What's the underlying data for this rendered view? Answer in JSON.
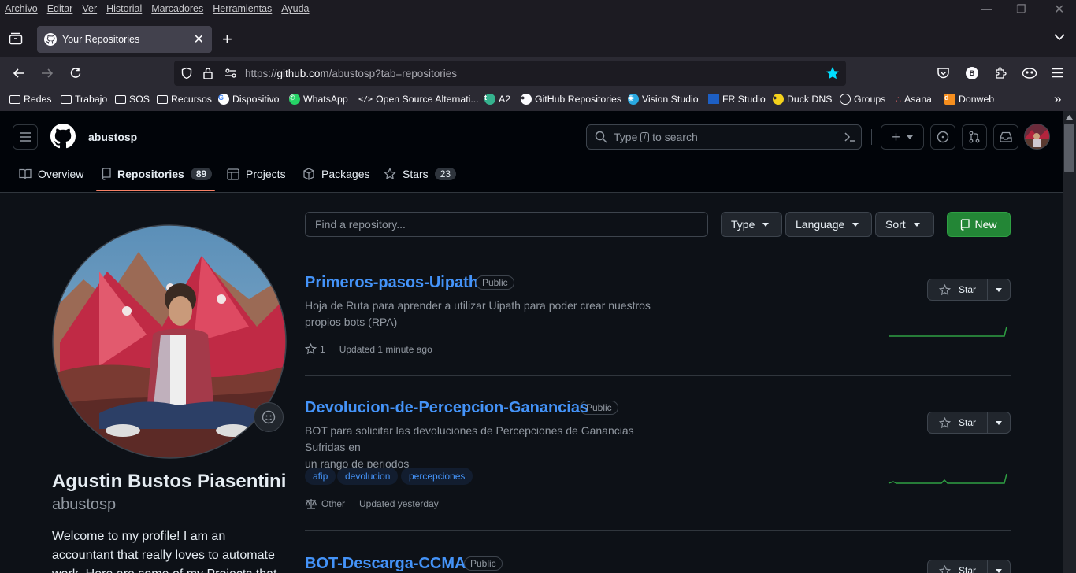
{
  "browser": {
    "menu": [
      "Archivo",
      "Editar",
      "Ver",
      "Historial",
      "Marcadores",
      "Herramientas",
      "Ayuda"
    ],
    "tab_title": "Your Repositories",
    "url_prefix": "https://",
    "url_domain": "github.com",
    "url_path": "/abustosp?tab=repositories",
    "extension_letter": "B",
    "bookmarks": [
      {
        "label": "Redes",
        "icon": "folder-icon"
      },
      {
        "label": "Trabajo",
        "icon": "folder-icon"
      },
      {
        "label": "SOS",
        "icon": "folder-icon"
      },
      {
        "label": "Recursos",
        "icon": "folder-icon"
      },
      {
        "label": "Dispositivo",
        "icon": "google-icon"
      },
      {
        "label": "WhatsApp",
        "icon": "whatsapp-icon"
      },
      {
        "label": "Open Source Alternati...",
        "icon": "code-icon"
      },
      {
        "label": "A2",
        "icon": "a2-icon"
      },
      {
        "label": "GitHub Repositories",
        "icon": "github-icon"
      },
      {
        "label": "Vision Studio",
        "icon": "vision-icon"
      },
      {
        "label": "FR Studio",
        "icon": "fr-studio-icon"
      },
      {
        "label": "Duck DNS",
        "icon": "duck-icon"
      },
      {
        "label": "Groups",
        "icon": "globe-icon"
      },
      {
        "label": "Asana",
        "icon": "asana-icon"
      },
      {
        "label": "Donweb",
        "icon": "donweb-icon"
      }
    ],
    "colors": {
      "accent": "#00ddff",
      "menubar_bg": "#1c1b22",
      "navbar_bg": "#2b2a33"
    }
  },
  "github": {
    "username": "abustosp",
    "search_placeholder_before": "Type",
    "search_key": "/",
    "search_placeholder_after": "to search",
    "tabs": [
      {
        "label": "Overview",
        "count": null,
        "icon": "book-icon"
      },
      {
        "label": "Repositories",
        "count": "89",
        "icon": "repo-icon"
      },
      {
        "label": "Projects",
        "count": null,
        "icon": "table-icon"
      },
      {
        "label": "Packages",
        "count": null,
        "icon": "package-icon"
      },
      {
        "label": "Stars",
        "count": "23",
        "icon": "star-icon"
      }
    ],
    "profile": {
      "full_name": "Agustin Bustos Piasentini",
      "login": "abustosp",
      "bio_lines": [
        "Welcome to my profile! I am an",
        "accountant that really loves to automate",
        "work. Here are some of my Projects that"
      ]
    },
    "find_placeholder": "Find a repository...",
    "filters": [
      "Type",
      "Language",
      "Sort"
    ],
    "new_button": "New",
    "star_label": "Star",
    "repos": [
      {
        "name": "Primeros-pasos-Uipath",
        "visibility": "Public",
        "description_lines": [
          "Hoja de Ruta para aprender a utilizar Uipath para poder crear nuestros",
          "propios bots (RPA)"
        ],
        "topics": [],
        "stars": "1",
        "license": "",
        "updated": "Updated 1 minute ago"
      },
      {
        "name": "Devolucion-de-Percepcion-Ganancias",
        "visibility": "Public",
        "description_lines": [
          "BOT para solicitar las devoluciones de Percepciones de Ganancias Sufridas en",
          "un rango de periodos"
        ],
        "topics": [
          "afip",
          "devolucion",
          "percepciones"
        ],
        "stars": "",
        "license": "Other",
        "updated": "Updated yesterday"
      },
      {
        "name": "BOT-Descarga-CCMA",
        "visibility": "Public",
        "description_lines": [],
        "topics": [],
        "stars": "",
        "license": "",
        "updated": ""
      }
    ],
    "colors": {
      "link": "#4493f8",
      "new_button": "#238636",
      "tab_underline": "#f78166",
      "sparkline": "#2ea043"
    }
  }
}
